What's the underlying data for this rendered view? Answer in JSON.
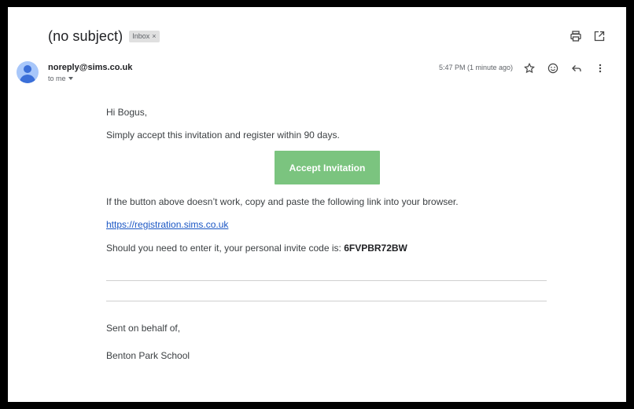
{
  "email": {
    "subject": "(no subject)",
    "label": "Inbox",
    "label_remove": "×",
    "sender": "noreply@sims.co.uk",
    "recipient": "to me",
    "time": "5:47 PM (1 minute ago)"
  },
  "icons": {
    "print": "print-icon",
    "popout": "open-in-new-icon",
    "star": "star-icon",
    "emoji": "emoji-icon",
    "reply": "reply-icon",
    "more": "more-vert-icon"
  },
  "body": {
    "greeting": "Hi Bogus,",
    "intro": "Simply accept this invitation and register within 90 days.",
    "button_label": "Accept Invitation",
    "fallback_text": "If the button above doesn’t work, copy and paste the following link into your browser.",
    "link_text": "https://registration.sims.co.uk",
    "code_text": "Should you need to enter it, your personal invite code is: ",
    "code": "6FVPBR72BW",
    "sent_behalf": "Sent on behalf of,",
    "school": "Benton Park School"
  },
  "colors": {
    "button_bg": "#7bc47f",
    "link": "#1a56c4",
    "frame_border": "#000000"
  }
}
